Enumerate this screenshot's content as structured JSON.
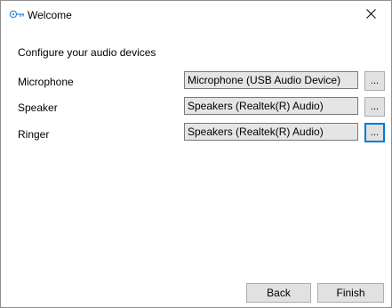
{
  "window": {
    "title": "Welcome",
    "close_glyph": "✕"
  },
  "main": {
    "heading": "Configure your audio devices",
    "devices": [
      {
        "label": "Microphone",
        "value": "Microphone (USB Audio Device)",
        "browse_label": "..."
      },
      {
        "label": "Speaker",
        "value": "Speakers (Realtek(R) Audio)",
        "browse_label": "..."
      },
      {
        "label": "Ringer",
        "value": "Speakers (Realtek(R) Audio)",
        "browse_label": "..."
      }
    ]
  },
  "footer": {
    "back_label": "Back",
    "finish_label": "Finish"
  },
  "icons": {
    "title_icon": "key-icon",
    "close_icon": "close-icon"
  },
  "colors": {
    "accent": "#0078d7",
    "field_background": "#e5e5e5",
    "button_background": "#e1e1e1"
  }
}
